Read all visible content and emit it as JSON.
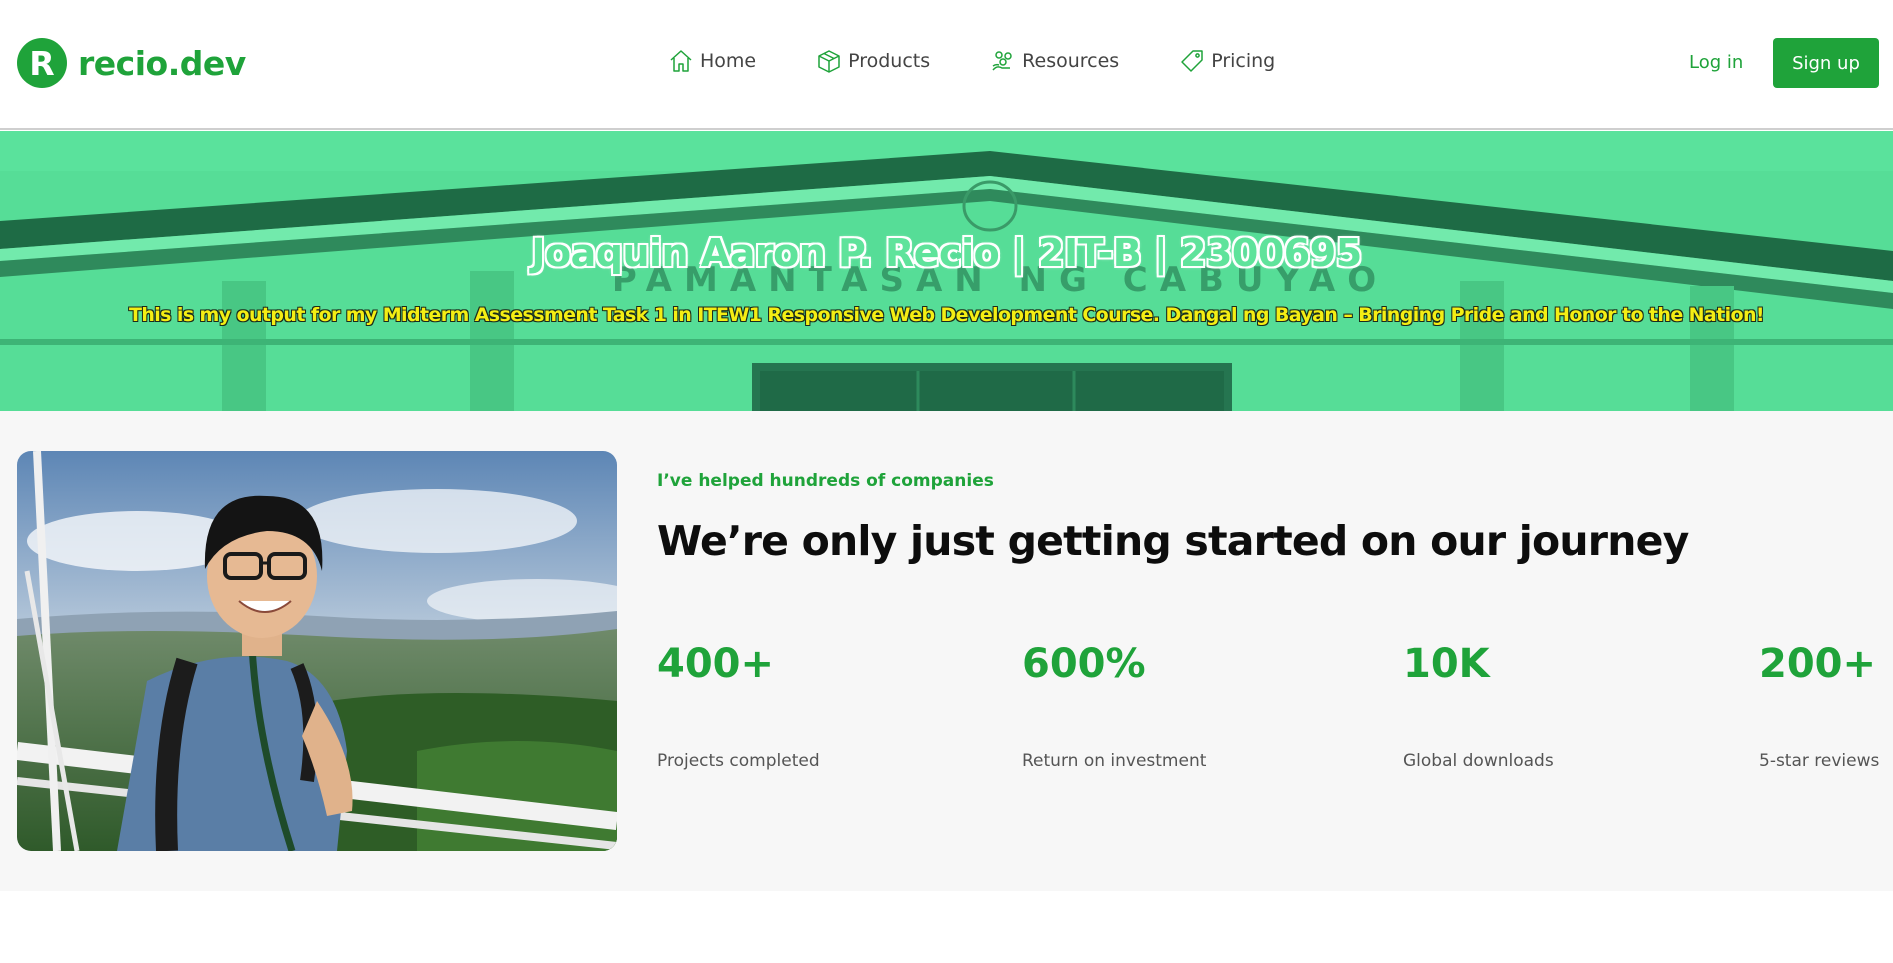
{
  "brand": {
    "logo_letter": "R",
    "name": "recio.dev",
    "accent": "#1fa33a"
  },
  "nav": {
    "items": [
      {
        "label": "Home",
        "icon": "home-icon"
      },
      {
        "label": "Products",
        "icon": "box-icon"
      },
      {
        "label": "Resources",
        "icon": "resources-icon"
      },
      {
        "label": "Pricing",
        "icon": "tag-icon"
      }
    ],
    "login_label": "Log in",
    "signup_label": "Sign up"
  },
  "hero": {
    "title": "Joaquin Aaron P. Recio | 2IT-B | 2300695",
    "subtitle": "This is my output for my Midterm Assessment Task 1 in ITEW1 Responsive Web Development Course. Dangal ng Bayan – Bringing Pride and Honor to the Nation!",
    "background_sign_text": "PAMANTASAN NG CABUYAO",
    "overlay_color": "#56dd97"
  },
  "stats_section": {
    "eyebrow": "I’ve helped hundreds of companies",
    "headline": "We’re only just getting started on our journey",
    "stats": [
      {
        "value": "400+",
        "label": "Projects completed"
      },
      {
        "value": "600%",
        "label": "Return on investment"
      },
      {
        "value": "10K",
        "label": "Global downloads"
      },
      {
        "value": "200+",
        "label": "5-star reviews"
      }
    ]
  }
}
